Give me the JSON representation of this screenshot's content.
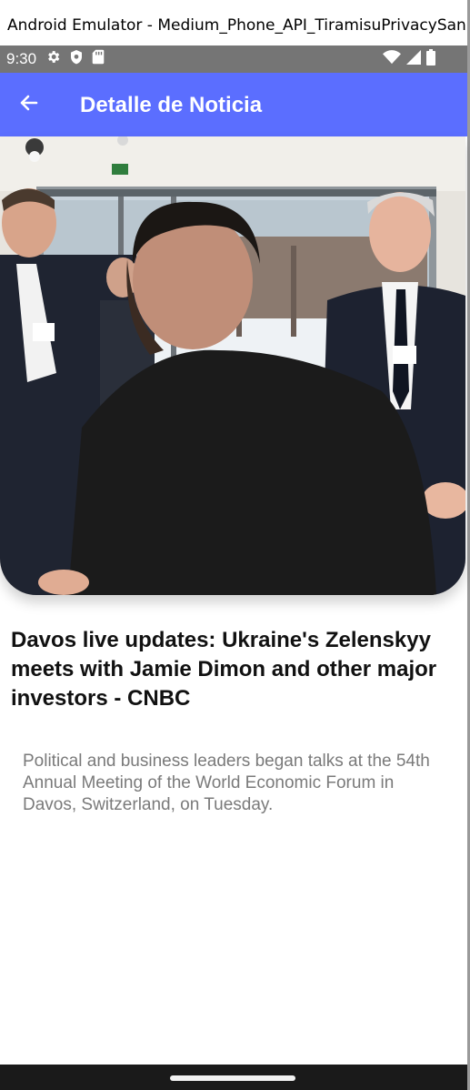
{
  "window": {
    "title": "Android Emulator - Medium_Phone_API_TiramisuPrivacySandb..."
  },
  "status_bar": {
    "time": "9:30",
    "left_icons": [
      "gear-icon",
      "shield-icon",
      "sd-card-icon"
    ],
    "right_icons": [
      "wifi-icon",
      "signal-icon",
      "battery-icon"
    ]
  },
  "app_bar": {
    "title": "Detalle de Noticia",
    "back_icon": "arrow-left-icon",
    "color": "#5b6eff"
  },
  "article": {
    "title": "Davos live updates: Ukraine's Zelenskyy meets with Jamie Dimon and other major investors - CNBC",
    "description": "Political and business leaders began talks at the 54th Annual Meeting of the World Economic Forum in Davos, Switzerland, on Tuesday.",
    "image": "news-photo"
  },
  "nav_bar": {
    "handle": "home-gesture-handle"
  }
}
